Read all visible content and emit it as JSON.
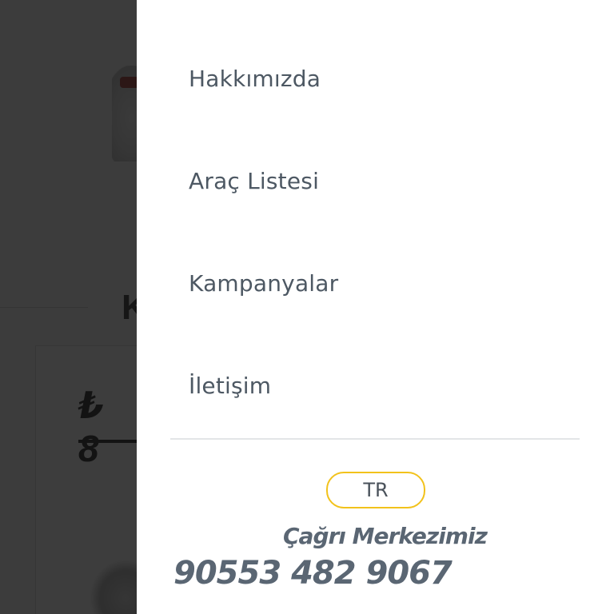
{
  "background": {
    "heading_fragment": "K",
    "price_fragment": "₺ 8"
  },
  "menu": {
    "items": [
      {
        "label": "Hakkımızda"
      },
      {
        "label": "Araç Listesi"
      },
      {
        "label": "Kampanyalar"
      },
      {
        "label": "İletişim"
      }
    ]
  },
  "language": {
    "label": "TR"
  },
  "contact": {
    "call_center_label": "Çağrı Merkezimiz",
    "phone": "90553 482 9067"
  },
  "colors": {
    "menu_text": "#4d5863",
    "accent_yellow": "#f2c21b",
    "contact_text": "#5a6673",
    "overlay": "rgba(20,20,20,0.82)"
  }
}
